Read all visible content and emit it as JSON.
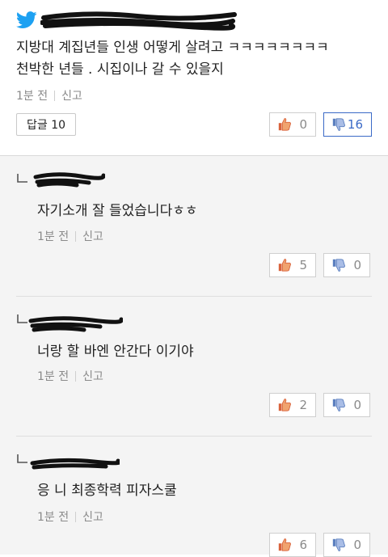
{
  "main_comment": {
    "text_line1": "지방대 계집년들 인생 어떻게 살려고 ㅋㅋㅋㅋㅋㅋㅋㅋ",
    "text_line2": "천박한 년들 . 시집이나 갈 수 있을지",
    "time": "1분 전",
    "report": "신고",
    "reply_label": "답글 10",
    "likes": "0",
    "dislikes": "16"
  },
  "replies": [
    {
      "text": "자기소개 잘 들었습니다ㅎㅎ",
      "time": "1분 전",
      "report": "신고",
      "likes": "5",
      "dislikes": "0"
    },
    {
      "text": "너랑 할 바엔 안간다 이기야",
      "time": "1분 전",
      "report": "신고",
      "likes": "2",
      "dislikes": "0"
    },
    {
      "text": "응 니 최종학력 피자스쿨",
      "time": "1분 전",
      "report": "신고",
      "likes": "6",
      "dislikes": "0"
    }
  ],
  "icons": {
    "source": "twitter-icon",
    "like": "thumbs-up-icon",
    "dislike": "thumbs-down-icon",
    "reply_marker": "reply-arrow-icon"
  },
  "colors": {
    "twitter": "#1da1f2",
    "dislike_active": "#3b6ac7",
    "like_icon": "#d9623b",
    "dislike_icon": "#5b7fbf",
    "reply_bg": "#f4f4f4"
  }
}
